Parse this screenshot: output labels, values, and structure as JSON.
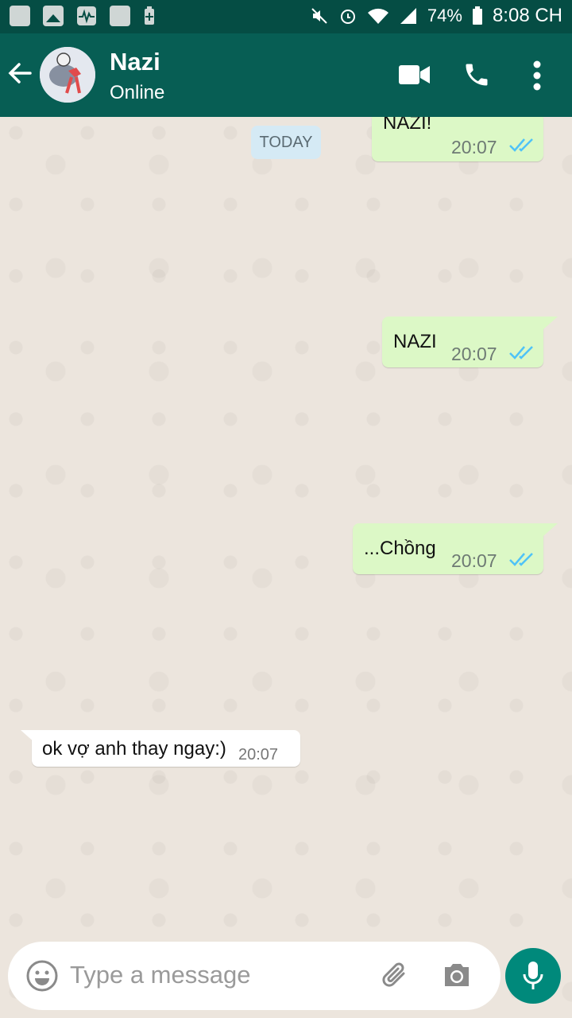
{
  "status_bar": {
    "battery": "74%",
    "time": "8:08 CH"
  },
  "header": {
    "contact_name": "Nazi",
    "status": "Online"
  },
  "chat": {
    "date_label": "TODAY",
    "messages": [
      {
        "direction": "out",
        "text": "NAZI!",
        "time": "20:07",
        "status": "read"
      },
      {
        "direction": "out",
        "text": "NAZI",
        "time": "20:07",
        "status": "read"
      },
      {
        "direction": "out",
        "text": "...Chồng",
        "time": "20:07",
        "status": "read"
      },
      {
        "direction": "in",
        "text": "ok vợ anh thay ngay:)",
        "time": "20:07"
      }
    ]
  },
  "composer": {
    "placeholder": "Type a message"
  },
  "colors": {
    "header": "#075e54",
    "status_bar": "#054d44",
    "outgoing_bubble": "#dcf8c6",
    "incoming_bubble": "#ffffff",
    "ticks": "#4fc3f7",
    "mic_button": "#00897b"
  },
  "icons": [
    "back-arrow-icon",
    "video-call-icon",
    "phone-icon",
    "more-vert-icon",
    "emoji-icon",
    "attach-icon",
    "camera-icon",
    "mic-icon",
    "double-check-icon"
  ]
}
